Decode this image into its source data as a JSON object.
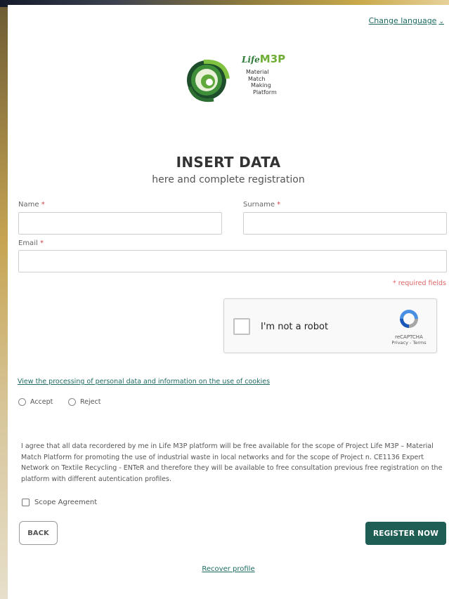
{
  "header": {
    "change_language": "Change language",
    "caret": "⌄"
  },
  "logo": {
    "life": "Life",
    "m3p": "M3P",
    "lines": [
      "Material",
      "Match",
      "Making",
      "Platform"
    ]
  },
  "form": {
    "title": "INSERT DATA",
    "subtitle": "here and complete registration",
    "name_label": "Name",
    "surname_label": "Surname",
    "email_label": "Email",
    "required_star": "*",
    "name_value": "",
    "surname_value": "",
    "email_value": "",
    "required_note": "* required fields"
  },
  "captcha": {
    "label": "I'm not a robot",
    "brand": "reCAPTCHA",
    "links": "Privacy - Terms"
  },
  "privacy": {
    "link": "View the processing of personal data and information on the use of cookies",
    "accept": "Accept",
    "reject": "Reject"
  },
  "agreement": {
    "text": "I agree that all data recordered by me in Life M3P platform will be free available for the scope of Project Life M3P – Material Match Platform for promoting the use of industrial waste in local networks and for the scope of Project n. CE1136 Expert Network on Textile Recycling - ENTeR and therefore they will be available to free consultation previous free registration on the platform with different autentication profiles.",
    "checkbox_label": "Scope Agreement"
  },
  "buttons": {
    "back": "BACK",
    "register": "REGISTER NOW",
    "recover": "Recover profile"
  },
  "colors": {
    "accent": "#1e5e55",
    "link": "#1e6b63",
    "required": "#dd6666"
  }
}
